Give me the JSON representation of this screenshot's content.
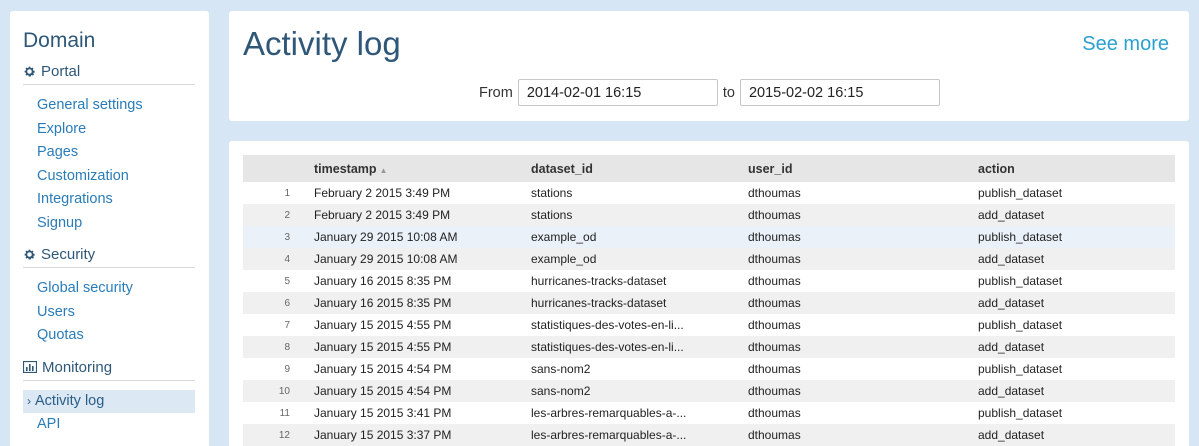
{
  "sidebar": {
    "title": "Domain",
    "sections": [
      {
        "name": "Portal",
        "icon": "gear-icon",
        "items": [
          "General settings",
          "Explore",
          "Pages",
          "Customization",
          "Integrations",
          "Signup"
        ]
      },
      {
        "name": "Security",
        "icon": "gear-icon",
        "items": [
          "Global security",
          "Users",
          "Quotas"
        ]
      },
      {
        "name": "Monitoring",
        "icon": "bar-chart-icon",
        "items": [
          "Activity log",
          "API"
        ],
        "active": "Activity log"
      }
    ]
  },
  "header": {
    "title": "Activity log",
    "see_more": "See more",
    "from_label": "From",
    "from_value": "2014-02-01 16:15",
    "to_label": "to",
    "to_value": "2015-02-02 16:15"
  },
  "table": {
    "columns": [
      "timestamp",
      "dataset_id",
      "user_id",
      "action"
    ],
    "sorted_column": "timestamp",
    "rows": [
      [
        "1",
        "February 2 2015 3:49 PM",
        "stations",
        "dthoumas",
        "publish_dataset"
      ],
      [
        "2",
        "February 2 2015 3:49 PM",
        "stations",
        "dthoumas",
        "add_dataset"
      ],
      [
        "3",
        "January 29 2015 10:08 AM",
        "example_od",
        "dthoumas",
        "publish_dataset"
      ],
      [
        "4",
        "January 29 2015 10:08 AM",
        "example_od",
        "dthoumas",
        "add_dataset"
      ],
      [
        "5",
        "January 16 2015 8:35 PM",
        "hurricanes-tracks-dataset",
        "dthoumas",
        "publish_dataset"
      ],
      [
        "6",
        "January 16 2015 8:35 PM",
        "hurricanes-tracks-dataset",
        "dthoumas",
        "add_dataset"
      ],
      [
        "7",
        "January 15 2015 4:55 PM",
        "statistiques-des-votes-en-li...",
        "dthoumas",
        "publish_dataset"
      ],
      [
        "8",
        "January 15 2015 4:55 PM",
        "statistiques-des-votes-en-li...",
        "dthoumas",
        "add_dataset"
      ],
      [
        "9",
        "January 15 2015 4:54 PM",
        "sans-nom2",
        "dthoumas",
        "publish_dataset"
      ],
      [
        "10",
        "January 15 2015 4:54 PM",
        "sans-nom2",
        "dthoumas",
        "add_dataset"
      ],
      [
        "11",
        "January 15 2015 3:41 PM",
        "les-arbres-remarquables-a-...",
        "dthoumas",
        "publish_dataset"
      ],
      [
        "12",
        "January 15 2015 3:37 PM",
        "les-arbres-remarquables-a-...",
        "dthoumas",
        "add_dataset"
      ]
    ]
  }
}
